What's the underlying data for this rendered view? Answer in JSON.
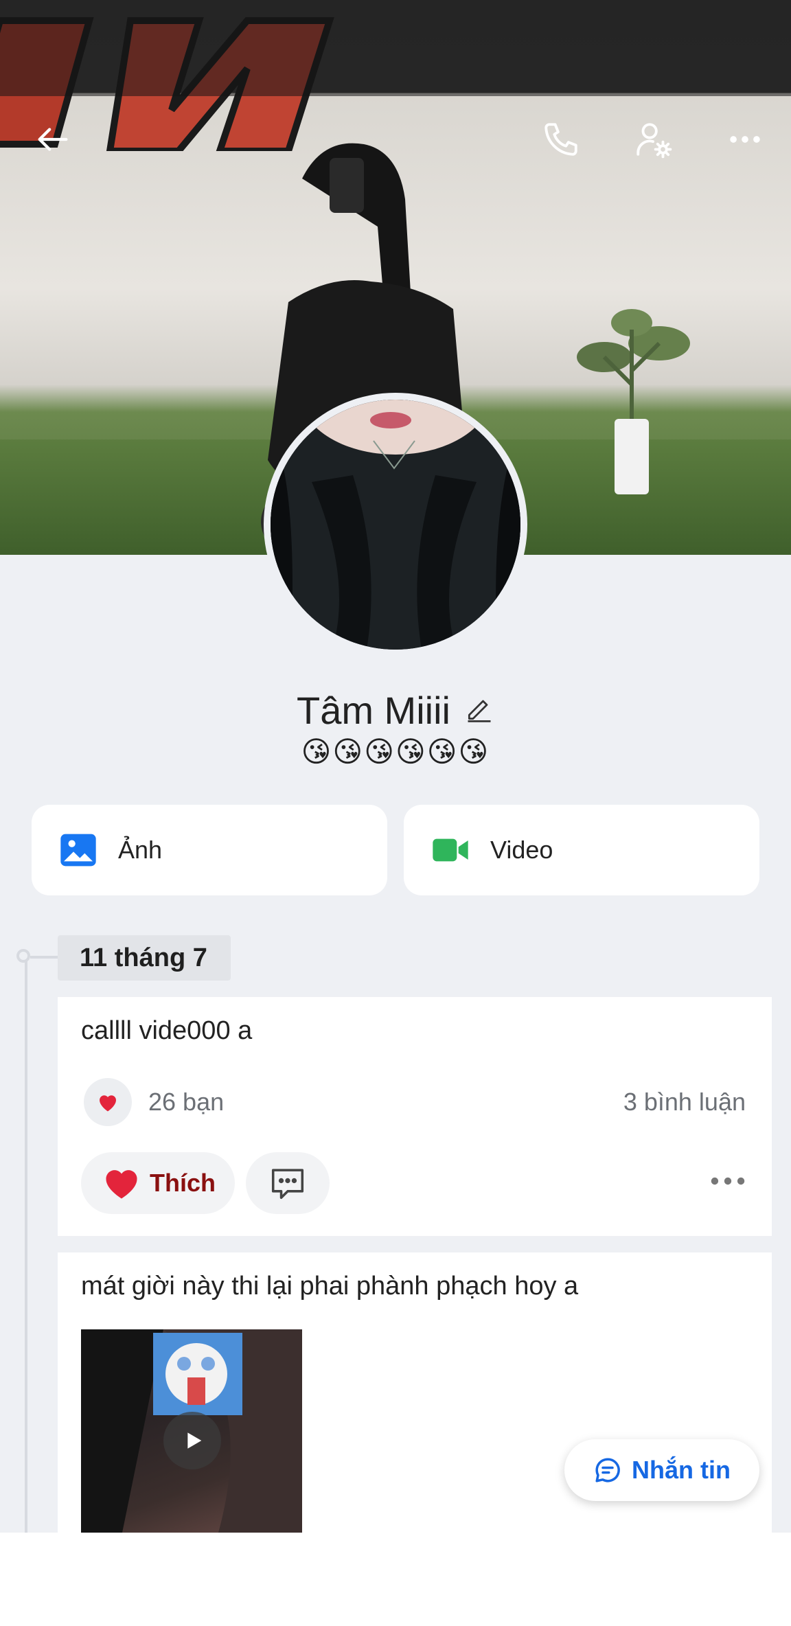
{
  "header": {
    "back_icon": "arrow-left-icon",
    "call_icon": "phone-icon",
    "settings_icon": "user-settings-icon",
    "more_icon": "more-horizontal-icon"
  },
  "profile": {
    "name": "Tâm Miiii",
    "bio": "😘😘😘😘😘😘"
  },
  "media_tiles": [
    {
      "label": "Ảnh",
      "icon": "photo-icon",
      "color": "#1877f2"
    },
    {
      "label": "Video",
      "icon": "video-camera-icon",
      "color": "#2fb55b"
    }
  ],
  "timeline": {
    "date_label": "11 tháng 7",
    "posts": [
      {
        "text": "callll vide000 a",
        "reactions": "26 bạn",
        "comments": "3 bình luận",
        "like_label": "Thích"
      },
      {
        "text": "mát giời này thi lại phai phành phạch hoy a"
      }
    ]
  },
  "message_button": {
    "label": "Nhắn tin"
  },
  "colors": {
    "background": "#eef0f4",
    "accent": "#1668e3",
    "like_text": "#8a1010"
  }
}
